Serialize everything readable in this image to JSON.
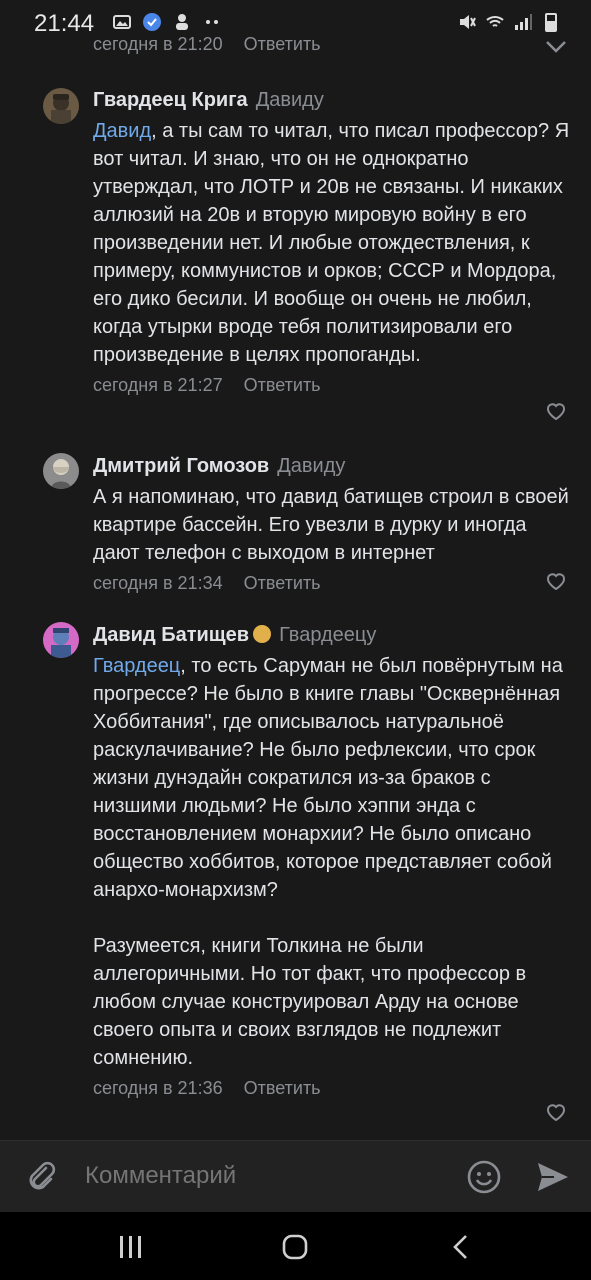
{
  "status": {
    "time": "21:44"
  },
  "top_cut": {
    "time": "сегодня в 21:20",
    "reply": "Ответить"
  },
  "comments": [
    {
      "author": "Гвардеец Крига",
      "reply_to": "Давиду",
      "mention": "Давид",
      "text": ", а ты сам то читал, что писал профессор? Я вот читал. И знаю, что он не однократно утверждал, что ЛОТР и 20в не связаны. И никаких аллюзий на 20в и вторую мировую войну в его произведении нет. И любые отождествления, к примеру, коммунистов и орков; СССР и Мордора, его дико бесили. И вообще он очень не любил, когда утырки вроде тебя политизировали его произведение в целях пропоганды.",
      "time": "сегодня в 21:27",
      "reply": "Ответить"
    },
    {
      "author": "Дмитрий Гомозов",
      "reply_to": "Давиду",
      "mention": "",
      "text": "А я напоминаю, что давид батищев строил в своей квартире бассейн. Его увезли в дурку и иногда дают телефон с выходом в интернет",
      "time": "сегодня в 21:34",
      "reply": "Ответить"
    },
    {
      "author": "Давид Батищев",
      "reply_to": "Гвардеецу",
      "mention": "Гвардеец",
      "text": ", то есть Саруман не был повёрнутым на прогрессе? Не было в книге главы \"Осквернённая Хоббитания\", где описывалось натуральноё раскулачивание? Не было рефлексии, что срок жизни дунэдайн сократился из-за браков с низшими людьми? Не было хэппи энда с восстановлением монархии? Не было описано общество хоббитов, которое представляет собой анархо-монархизм?\n\nРазумеется, книги Толкина не были аллегоричными. Но тот факт, что профессор в любом случае конструировал Арду на основе своего опыта и своих взглядов не подлежит сомнению.",
      "time": "сегодня в 21:36",
      "reply": "Ответить"
    }
  ],
  "composer": {
    "placeholder": "Комментарий"
  },
  "colors": {
    "background": "#19191a",
    "mention": "#71aaeb",
    "secondary": "#8a8d91"
  }
}
